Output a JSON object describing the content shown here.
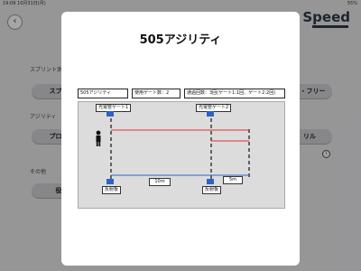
{
  "status_bar": {
    "time": "19:09",
    "date": "10月31日(月)",
    "battery": "55%"
  },
  "header": {
    "logo": "Speed"
  },
  "background": {
    "section_sprint": "スプリント測",
    "sprint_button": "スプリ",
    "sprint_free_button": "ト・フリー",
    "section_agility": "アジリティ",
    "agility_left_button": "プロア",
    "agility_right_button": "リル",
    "section_other": "その他",
    "other_button": "役"
  },
  "modal": {
    "title": "505アジリティ",
    "info_name": "505アジリティ",
    "info_gates": "使用ゲート数：2",
    "info_passes": "通過回数：3回(ゲート1:1回、ゲート2:2回)",
    "gate1_label": "光電管ゲート1",
    "gate2_label": "光電管ゲート2",
    "reflector1_label": "反射板",
    "reflector2_label": "反射板",
    "distance_a": "10m",
    "distance_b": "5m"
  },
  "colors": {
    "sensor": "#2f62c8",
    "path_red": "#e03030",
    "baseline_blue": "#2f62c8"
  }
}
